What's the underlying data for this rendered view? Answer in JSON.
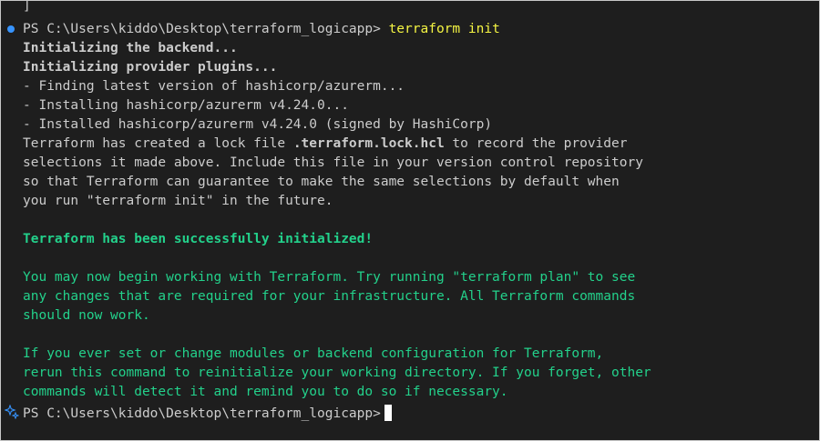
{
  "terminal": {
    "top_fragment": "]",
    "prompt1": {
      "path": "PS C:\\Users\\kiddo\\Desktop\\terraform_logicapp>",
      "command": "terraform init"
    },
    "init_backend": "Initializing the backend...",
    "init_plugins": "Initializing provider plugins...",
    "finding": "- Finding latest version of hashicorp/azurerm...",
    "installing": "- Installing hashicorp/azurerm v4.24.0...",
    "installed": "- Installed hashicorp/azurerm v4.24.0 (signed by HashiCorp)",
    "lock_line1_a": "Terraform has created a lock file ",
    "lock_file": ".terraform.lock.hcl",
    "lock_line1_b": " to record the provider",
    "lock_line2": "selections it made above. Include this file in your version control repository",
    "lock_line3": "so that Terraform can guarantee to make the same selections by default when",
    "lock_line4": "you run \"terraform init\" in the future.",
    "success": "Terraform has been successfully initialized!",
    "begin_line1": "You may now begin working with Terraform. Try running \"terraform plan\" to see",
    "begin_line2": "any changes that are required for your infrastructure. All Terraform commands",
    "begin_line3": "should now work.",
    "rerun_line1": "If you ever set or change modules or backend configuration for Terraform,",
    "rerun_line2": "rerun this command to reinitialize your working directory. If you forget, other",
    "rerun_line3": "commands will detect it and remind you to do so if necessary.",
    "prompt2": {
      "path": "PS C:\\Users\\kiddo\\Desktop\\terraform_logicapp>"
    }
  },
  "colors": {
    "background": "#1e1e1e",
    "text": "#cccccc",
    "success_green": "#23d18b",
    "command_yellow": "#f5f543",
    "decoration_blue": "#3794ff"
  }
}
